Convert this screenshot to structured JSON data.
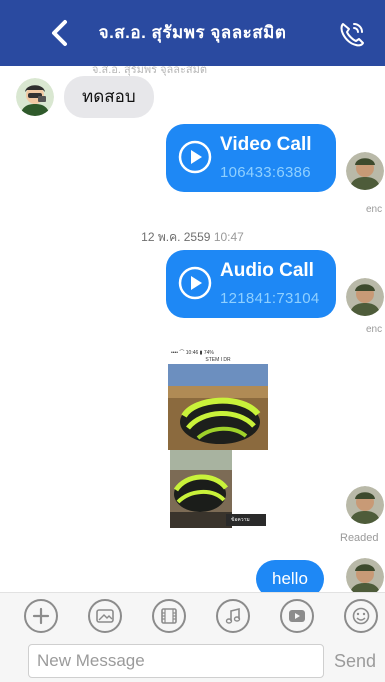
{
  "header": {
    "title": "จ.ส.อ. สุรัมพร จุลละสมิต",
    "back_icon": "chevron-left-icon",
    "call_icon": "phone-call-icon",
    "bg_color": "#2a4aa0"
  },
  "messages": {
    "clipped_sender_name": "จ.ส.อ. สุรัมพร จุลละสมิต",
    "incoming_text": "ทดสอบ",
    "video_call": {
      "title": "Video Call",
      "id": "106433:6386",
      "status": "enc"
    },
    "date_time": {
      "date": "12 พ.ค. 2559",
      "time": "10:47"
    },
    "audio_call": {
      "title": "Audio Call",
      "id": "121841:73104",
      "status": "enc"
    },
    "photo1": {
      "statusbar": "•••• ⌒  10:46  ▮ 74%",
      "appbar": "STEM I DR"
    },
    "photo2": {
      "caption": "ข้อความ"
    },
    "photos_status": "Readed",
    "outgoing_text": "hello",
    "outgoing_color": "#1e88f5"
  },
  "attach_bar": {
    "icons": [
      "plus-icon",
      "sticker-icon",
      "video-film-icon",
      "music-note-icon",
      "play-video-icon",
      "emoji-icon"
    ]
  },
  "compose": {
    "placeholder": "New Message",
    "send_label": "Send"
  }
}
